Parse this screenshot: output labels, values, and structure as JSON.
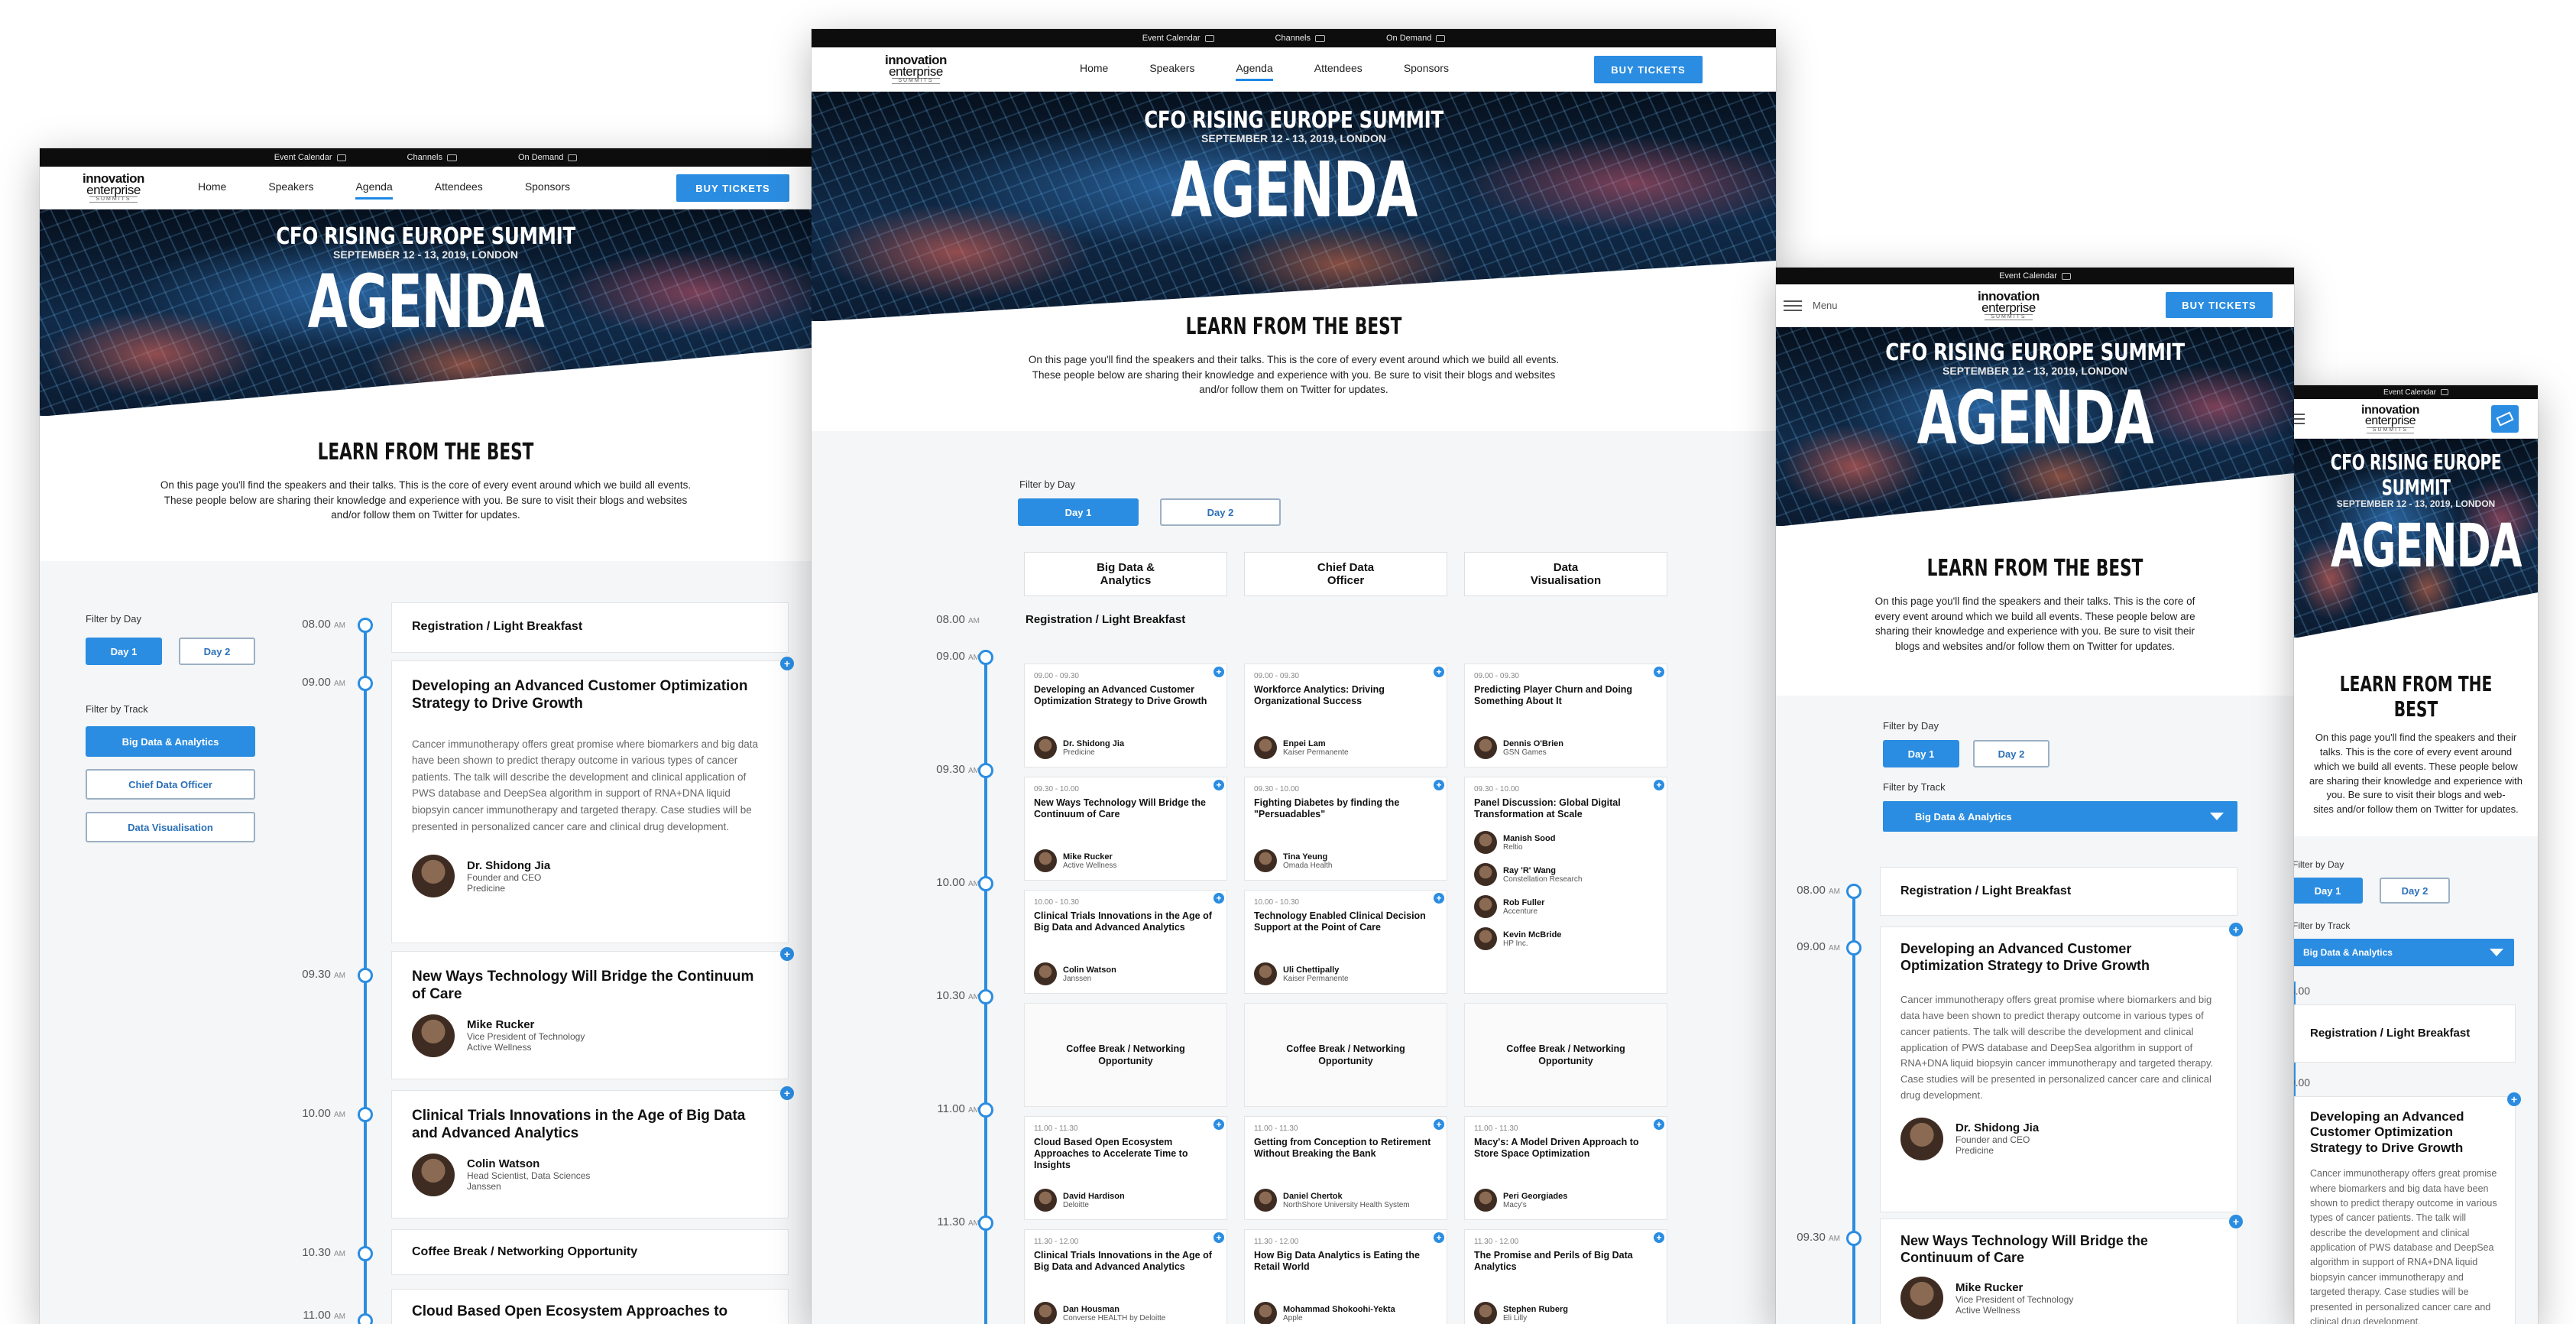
{
  "topbar": {
    "event_calendar": "Event Calendar",
    "channels": "Channels",
    "on_demand": "On Demand"
  },
  "logo": {
    "line1": "innovation",
    "line2": "enterprise",
    "line3": "SUMMITS"
  },
  "nav": {
    "home": "Home",
    "speakers": "Speakers",
    "agenda": "Agenda",
    "attendees": "Attendees",
    "sponsors": "Sponsors",
    "buy": "BUY TICKETS",
    "menu": "Menu"
  },
  "hero": {
    "summit": "CFO RISING EUROPE SUMMIT",
    "date": "SEPTEMBER 12 - 13, 2019, LONDON",
    "title": "AGENDA"
  },
  "learn": {
    "heading": "LEARN FROM THE BEST",
    "text": "On this page you'll find the speakers and their talks. This is the core of every event around which we build all events. These people below are sharing their knowledge and experience with you. Be sure to visit their blogs and websites and/or follow them on Twitter for updates.",
    "text_lines_a": [
      "On this page you'll find the speakers and their talks. This is the core of every event around which we build all events.",
      "These people below are sharing their knowledge and experience with you. Be sure to visit their blogs and websites",
      "and/or follow them on Twitter for updates."
    ],
    "text_lines_c": [
      "On this page you'll find the speakers and their talks. This is the core of",
      "every event around which we build all events. These people below are",
      "sharing their knowledge and experience with you. Be sure to visit their",
      "blogs and websites and/or follow them on Twitter for updates."
    ],
    "text_lines_d": [
      "On this page you'll find the speakers and their",
      "talks. This is the core of every event around",
      "which we build all events. These people below",
      "are sharing their knowledge and experience with",
      "you. Be sure to visit their blogs and web-",
      "sites and/or follow them on Twitter for updates."
    ]
  },
  "filters": {
    "by_day": "Filter by Day",
    "day1": "Day 1",
    "day2": "Day 2",
    "by_track": "Filter by Track",
    "track1": "Big Data & Analytics",
    "track2": "Chief Data Officer",
    "track3": "Data Visualisation"
  },
  "ampm": "AM",
  "tracks": [
    "Big Data & Analytics",
    "Chief Data Officer",
    "Data Visualisation"
  ],
  "sessions": {
    "breakfast": {
      "time": "08.00",
      "title": "Registration / Light Breakfast"
    },
    "s1": {
      "time": "09.00",
      "title": "Developing an Advanced Customer Optimization Strategy to Drive Growth",
      "desc": "Cancer immunotherapy offers great promise where biomarkers and big data have been shown to predict therapy outcome in various types of cancer patients. The talk will describe the development and clinical application of PWS database and DeepSea algorithm in support of RNA+DNA liquid biopsyin cancer immunotherapy and targeted therapy. Case studies will be presented in personalized cancer care and clinical drug development.",
      "speaker": "Dr. Shidong Jia",
      "role": "Founder and CEO",
      "company": "Predicine"
    },
    "s2": {
      "time": "09.30",
      "title": "New Ways Technology Will Bridge the Continuum of Care",
      "speaker": "Mike Rucker",
      "role": "Vice President of Technology",
      "company": "Active Wellness"
    },
    "s3": {
      "time": "10.00",
      "title": "Clinical Trials Innovations in the Age of Big Data and Advanced Analytics",
      "speaker": "Colin Watson",
      "role": "Head Scientist, Data Sciences",
      "company": "Janssen"
    },
    "coffee": {
      "time": "10.30",
      "title": "Coffee Break / Networking Opportunity"
    },
    "s4": {
      "time": "11.00",
      "title": "Cloud Based Open Ecosystem Approaches to"
    }
  },
  "grid": {
    "times": [
      "08.00",
      "09.00",
      "09.30",
      "10.00",
      "10.30",
      "11.00",
      "11.30"
    ],
    "row1": [
      {
        "slot": "09.00 - 09.30",
        "title": "Developing an Advanced Customer Optimization Strategy to Drive Growth",
        "speakers": [
          {
            "name": "Dr. Shidong Jia",
            "co": "Predicine"
          }
        ]
      },
      {
        "slot": "09.00 - 09.30",
        "title": "Workforce Analytics: Driving Organizational Success",
        "speakers": [
          {
            "name": "Enpei Lam",
            "co": "Kaiser Permanente"
          }
        ]
      },
      {
        "slot": "09.00 - 09.30",
        "title": "Predicting Player Churn and Doing Something About It",
        "speakers": [
          {
            "name": "Dennis O'Brien",
            "co": "GSN Games"
          }
        ]
      }
    ],
    "row2": [
      {
        "slot": "09.30 - 10.00",
        "title": "New Ways Technology Will Bridge the Continuum of Care",
        "speakers": [
          {
            "name": "Mike Rucker",
            "co": "Active Wellness"
          }
        ]
      },
      {
        "slot": "09.30 - 10.00",
        "title": "Fighting Diabetes by finding the \"Persuadables\"",
        "speakers": [
          {
            "name": "Tina Yeung",
            "co": "Omada Health"
          }
        ]
      },
      {
        "slot": "09.30 - 10.00",
        "title": "Panel Discussion: Global Digital Transformation at Scale",
        "speakers": [
          {
            "name": "Manish Sood",
            "co": "Reltio"
          },
          {
            "name": "Ray 'R' Wang",
            "co": "Constellation Research"
          },
          {
            "name": "Rob Fuller",
            "co": "Accenture"
          },
          {
            "name": "Kevin McBride",
            "co": "HP Inc."
          }
        ]
      }
    ],
    "row3": [
      {
        "slot": "10.00 - 10.30",
        "title": "Clinical Trials Innovations in the Age of Big Data and Advanced Analytics",
        "speakers": [
          {
            "name": "Colin Watson",
            "co": "Janssen"
          }
        ]
      },
      {
        "slot": "10.00 - 10.30",
        "title": "Technology Enabled Clinical Decision Support at the Point of Care",
        "speakers": [
          {
            "name": "Uli Chettipally",
            "co": "Kaiser Permanente"
          }
        ]
      }
    ],
    "coffee": "Coffee Break / Networking Opportunity",
    "row5": [
      {
        "slot": "11.00 - 11.30",
        "title": "Cloud Based Open Ecosystem Approaches to Accelerate Time to Insights",
        "speakers": [
          {
            "name": "David Hardison",
            "co": "Deloitte"
          }
        ]
      },
      {
        "slot": "11.00 - 11.30",
        "title": "Getting from Conception to Retirement Without Breaking the Bank",
        "speakers": [
          {
            "name": "Daniel Chertok",
            "co": "NorthShore University Health System"
          }
        ]
      },
      {
        "slot": "11.00 - 11.30",
        "title": "Macy's: A Model Driven Approach to Store Space Optimization",
        "speakers": [
          {
            "name": "Peri Georgiades",
            "co": "Macy's"
          }
        ]
      }
    ],
    "row6": [
      {
        "slot": "11.30 - 12.00",
        "title": "Clinical Trials Innovations in the Age of Big Data and Advanced Analytics",
        "speakers": [
          {
            "name": "Dan Housman",
            "co": "Converse HEALTH by Deloitte"
          }
        ]
      },
      {
        "slot": "11.30 - 12.00",
        "title": "How Big Data Analytics is Eating the Retail World",
        "speakers": [
          {
            "name": "Mohammad Shokoohi-Yekta",
            "co": "Apple"
          }
        ]
      },
      {
        "slot": "11.30 - 12.00",
        "title": "The Promise and Perils of Big Data Analytics",
        "speakers": [
          {
            "name": "Stephen Ruberg",
            "co": "Eli Lilly"
          }
        ]
      }
    ]
  },
  "colors": {
    "accent": "#2b8de1",
    "topbar": "#0d0d0d",
    "section_gray": "#f5f6f7"
  }
}
